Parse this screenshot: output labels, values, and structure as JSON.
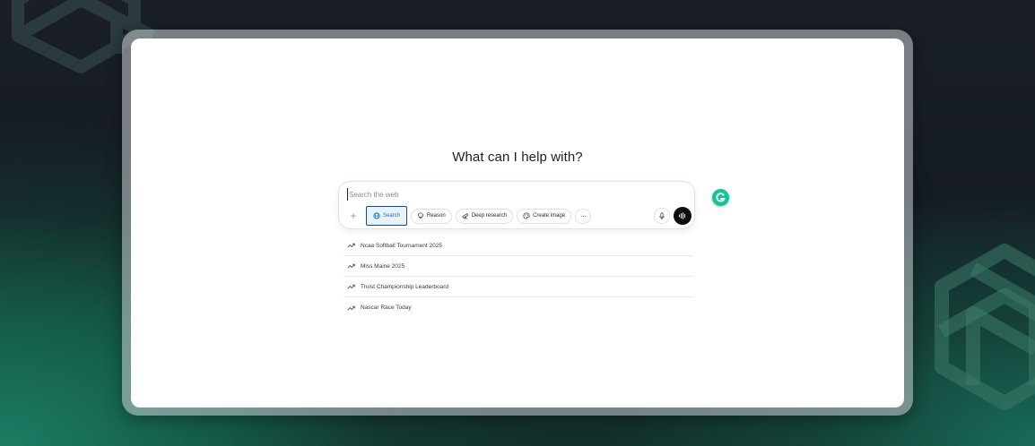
{
  "hero": {
    "title": "What can I help with?"
  },
  "composer": {
    "placeholder": "Search the web",
    "value": ""
  },
  "toolbar": {
    "tools": [
      {
        "label": "Search",
        "icon": "globe-icon",
        "active": true
      },
      {
        "label": "Reason",
        "icon": "lightbulb-icon",
        "active": false
      },
      {
        "label": "Deep research",
        "icon": "telescope-icon",
        "active": false
      },
      {
        "label": "Create image",
        "icon": "palette-icon",
        "active": false
      }
    ],
    "more_label": "···",
    "plus_label": "+"
  },
  "suggestions": [
    {
      "label": "Ncaa Softball Tournament 2025",
      "icon": "trending-icon"
    },
    {
      "label": "Miss Maine 2025",
      "icon": "trending-icon"
    },
    {
      "label": "Truist Championship Leaderboard",
      "icon": "trending-icon"
    },
    {
      "label": "Nascar Race Today",
      "icon": "trending-icon"
    }
  ],
  "colors": {
    "accent": "#1a6fd0",
    "active_chip_bg": "#e8f2fd",
    "grammarly": "#15c39a",
    "voice_button": "#0d0d0d"
  }
}
